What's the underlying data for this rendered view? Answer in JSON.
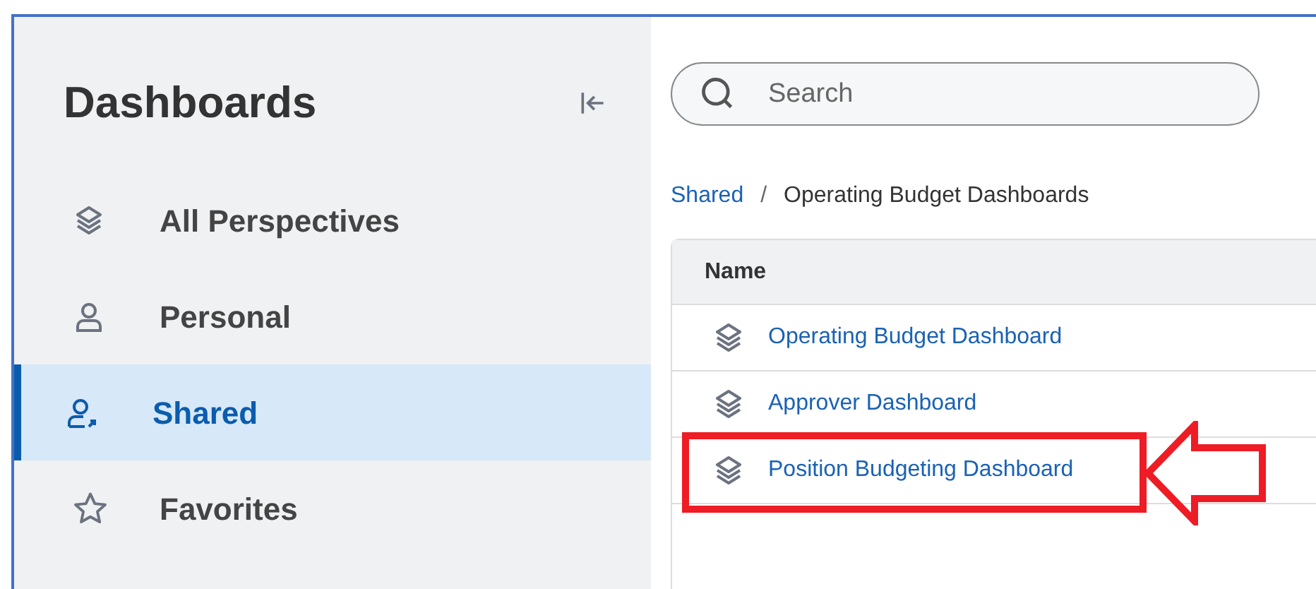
{
  "sidebar": {
    "title": "Dashboards",
    "items": [
      {
        "label": "All Perspectives",
        "kind": "layers",
        "selected": false
      },
      {
        "label": "Personal",
        "kind": "person",
        "selected": false
      },
      {
        "label": "Shared",
        "kind": "shared",
        "selected": true
      },
      {
        "label": "Favorites",
        "kind": "star",
        "selected": false
      }
    ]
  },
  "search": {
    "placeholder": "Search"
  },
  "breadcrumb": [
    {
      "label": "Shared",
      "kind": "link"
    },
    {
      "label": "/",
      "kind": "separator"
    },
    {
      "label": "Operating Budget Dashboards",
      "kind": "current"
    }
  ],
  "table": {
    "columns": [
      "Name"
    ],
    "rows": [
      {
        "name": "Operating Budget Dashboard",
        "highlighted": false
      },
      {
        "name": "Approver Dashboard",
        "highlighted": false
      },
      {
        "name": "Position Budgeting Dashboard",
        "highlighted": true
      }
    ]
  }
}
